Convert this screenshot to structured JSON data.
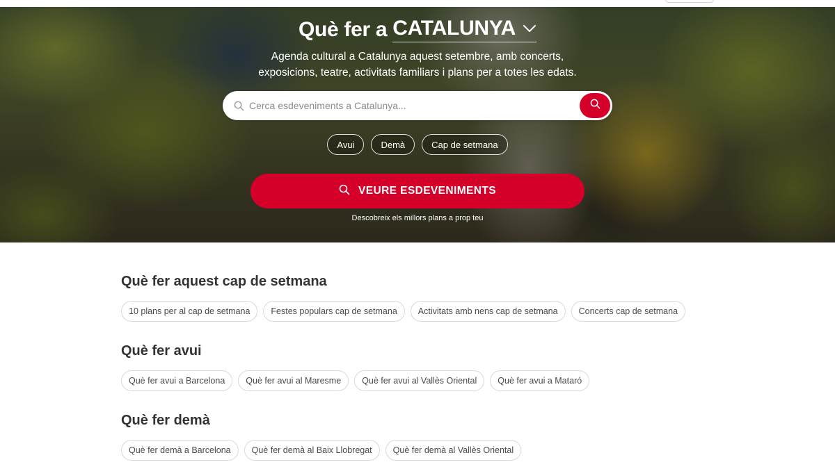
{
  "hero": {
    "title_prefix": "Què fer a",
    "region": "CATALUNYA",
    "subtitle_line1": "Agenda cultural a Catalunya aquest setembre, amb concerts,",
    "subtitle_line2": "exposicions, teatre, activitats familiars i plans per a totes les edats.",
    "search": {
      "placeholder": "Cerca esdeveniments a Catalunya...",
      "value": ""
    },
    "quick_filters": [
      "Avui",
      "Demà",
      "Cap de setmana"
    ],
    "cta_label": "VEURE ESDEVENIMENTS",
    "cta_note": "Descobreix els millors plans a prop teu",
    "accent_color": "#d4002a"
  },
  "sections": [
    {
      "title": "Què fer aquest cap de setmana",
      "chips": [
        "10 plans per al cap de setmana",
        "Festes populars cap de setmana",
        "Activitats amb nens cap de setmana",
        "Concerts cap de setmana"
      ]
    },
    {
      "title": "Què fer avui",
      "chips": [
        "Què fer avui a Barcelona",
        "Què fer avui al Maresme",
        "Què fer avui al Vallès Oriental",
        "Què fer avui a Mataró"
      ]
    },
    {
      "title": "Què fer demà",
      "chips": [
        "Què fer demà a Barcelona",
        "Què fer demà al Baix Llobregat",
        "Què fer demà al Vallès Oriental"
      ]
    }
  ],
  "icons": {
    "search": "search-icon",
    "chevron": "chevron-down-icon"
  }
}
